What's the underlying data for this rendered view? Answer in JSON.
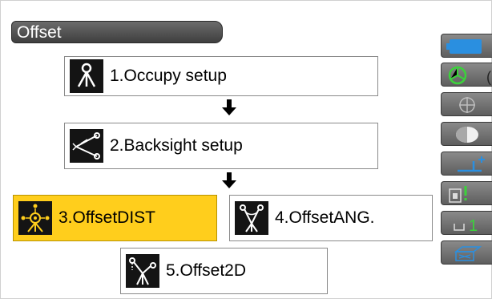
{
  "title": "Offset",
  "steps": {
    "occupy": "1.Occupy setup",
    "backsight": "2.Backsight setup",
    "offset_dist": "3.OffsetDIST",
    "offset_ang": "4.OffsetANG.",
    "offset_2d": "5.Offset2D"
  },
  "side_panel": {
    "partial_text": "(",
    "green_digit": "1"
  },
  "colors": {
    "active_step": "#ffce1c",
    "side_blue": "#2a8fe0",
    "side_green": "#3bd23b"
  },
  "icons": {
    "occupy": "tripod-icon",
    "backsight": "backsight-icon",
    "offset_dist": "offset-dist-icon",
    "offset_ang": "offset-angle-icon",
    "offset_2d": "offset-2d-icon"
  }
}
